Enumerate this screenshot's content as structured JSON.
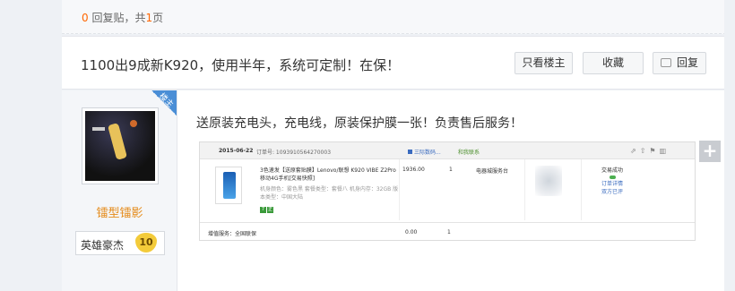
{
  "topbar": {
    "reply_num": "0",
    "reply_text": " 回复贴，共",
    "page_num": "1",
    "page_unit": "页"
  },
  "post": {
    "title": "1100出9成新K920，使用半年，系统可定制！在保！",
    "buttons": {
      "only_author": "只看楼主",
      "favorite": "收藏",
      "reply": "回复"
    },
    "body_text": "送原装充电头，充电线，原装保护膜一张！负责售后服务！"
  },
  "author": {
    "corner_tag": "楼主",
    "name": "镭型镭影",
    "badge_label": "英雄豪杰",
    "badge_level": "10",
    "avatar_icon": "basketball-player-avatar"
  },
  "order": {
    "date": "2015-06-22",
    "order_no": "订单号: 1093910564270003",
    "shop": "三际数码...",
    "contact": "和我联系",
    "product_title": "3色速发【送原套贴膜】Lenovo/联想 K920 VIBE Z2Pro移动4G手机[交易快照]",
    "product_attr": "机身颜色：雾色黑 套餐类型：套餐八 机身内存：32GB 版本类型：中国大陆",
    "price": "1936.00",
    "qty": "1",
    "store": "电器城服务台",
    "status_line1": "交易成功",
    "status_link1": "订单详情",
    "status_link2": "双方已评",
    "footer_service": "增值服务：全国联保",
    "footer_amount": "0.00",
    "footer_qty": "1"
  },
  "colors": {
    "accent_blue": "#4a8ed6",
    "username_orange": "#e58b1a",
    "reply_num_orange": "#ff6600"
  }
}
